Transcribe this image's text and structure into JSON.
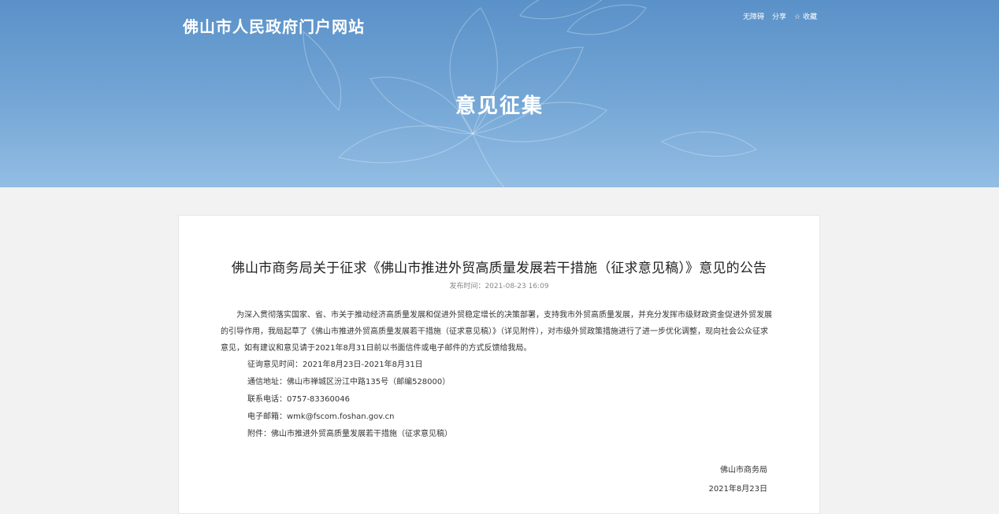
{
  "header": {
    "site_title": "佛山市人民政府门户网站",
    "links": {
      "accessibility": "无障碍",
      "share": "分享",
      "favorite": "☆ 收藏"
    },
    "page_heading": "意见征集"
  },
  "colors": {
    "banner_top": "#5a91c8",
    "banner_bottom": "#93bde3",
    "page_background": "#f2f2f2"
  },
  "notice": {
    "title": "佛山市商务局关于征求《佛山市推进外贸高质量发展若干措施（征求意见稿）》意见的公告",
    "publish_time": "发布时间：2021-08-23 16:09",
    "paragraph": "为深入贯彻落实国家、省、市关于推动经济高质量发展和促进外贸稳定增长的决策部署，支持我市外贸高质量发展，并充分发挥市级财政资金促进外贸发展的引导作用，我局起草了《佛山市推进外贸高质量发展若干措施（征求意见稿）》（详见附件），对市级外贸政策措施进行了进一步优化调整，现向社会公众征求意见，如有建议和意见请于2021年8月31日前以书面信件或电子邮件的方式反馈给我局。",
    "details": {
      "period": "征询意见时间：2021年8月23日-2021年8月31日",
      "address": "通信地址：佛山市禅城区汾江中路135号（邮编528000）",
      "phone": "联系电话：0757-83360046",
      "email": "电子邮箱：wmk@fscom.foshan.gov.cn",
      "attachment": "附件：佛山市推进外贸高质量发展若干措施（征求意见稿）"
    },
    "signature": {
      "org": "佛山市商务局",
      "date": "2021年8月23日"
    }
  }
}
